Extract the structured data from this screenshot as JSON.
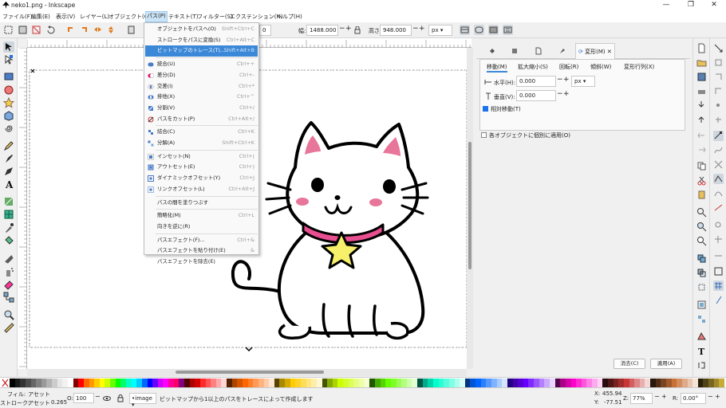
{
  "window": {
    "title": "neko1.png - Inkscape",
    "min": "—",
    "max": "❐",
    "close": "✕"
  },
  "menubar": [
    {
      "label": "ファイル(F)",
      "active": false
    },
    {
      "label": "編集(E)",
      "active": false
    },
    {
      "label": "表示(V)",
      "active": false
    },
    {
      "label": "レイヤー(L)",
      "active": false
    },
    {
      "label": "オブジェクト(O)",
      "active": false
    },
    {
      "label": "パス(P)",
      "active": true
    },
    {
      "label": "テキスト(T)",
      "active": false
    },
    {
      "label": "フィルター(S)",
      "active": false
    },
    {
      "label": "エクステンション(N)",
      "active": false
    },
    {
      "label": "ヘルプ(H)",
      "active": false
    }
  ],
  "command_bar": {
    "width_label": "幅:",
    "width_value": "1488.000",
    "height_label": "高さ:",
    "height_value": "948.000",
    "unit": "px",
    "partial_value": "0"
  },
  "path_menu": [
    {
      "label": "オブジェクトをパスへ(O)",
      "shortcut": "Shift+Ctrl+C",
      "icon": "none"
    },
    {
      "label": "ストロークをパスに変換(S)",
      "shortcut": "Ctrl+Alt+C",
      "icon": "none"
    },
    {
      "label": "ビットマップのトレース(T)...",
      "shortcut": "Shift+Alt+B",
      "icon": "none",
      "highlight": true
    },
    {
      "sep": true
    },
    {
      "label": "統合(U)",
      "shortcut": "Ctrl++",
      "icon": "union"
    },
    {
      "label": "差分(D)",
      "shortcut": "Ctrl+-",
      "icon": "difference"
    },
    {
      "label": "交差(I)",
      "shortcut": "Ctrl+*",
      "icon": "intersection"
    },
    {
      "label": "排他(X)",
      "shortcut": "Ctrl+^",
      "icon": "exclusion"
    },
    {
      "label": "分割(V)",
      "shortcut": "Ctrl+/",
      "icon": "division"
    },
    {
      "label": "パスをカット(P)",
      "shortcut": "Ctrl+Alt+/",
      "icon": "cut-path"
    },
    {
      "sep": true
    },
    {
      "label": "結合(C)",
      "shortcut": "Ctrl+K",
      "icon": "combine"
    },
    {
      "label": "分解(A)",
      "shortcut": "Shift+Ctrl+K",
      "icon": "break-apart"
    },
    {
      "sep": true
    },
    {
      "label": "インセット(N)",
      "shortcut": "Ctrl+(",
      "icon": "inset"
    },
    {
      "label": "アウトセット(E)",
      "shortcut": "Ctrl+)",
      "icon": "outset"
    },
    {
      "label": "ダイナミックオフセット(Y)",
      "shortcut": "Ctrl+J",
      "icon": "dynamic-offset"
    },
    {
      "label": "リンクオフセット(L)",
      "shortcut": "Ctrl+Alt+J",
      "icon": "linked-offset"
    },
    {
      "sep": true
    },
    {
      "label": "パスの間を塗りつぶす",
      "shortcut": "",
      "icon": "none"
    },
    {
      "sep": true
    },
    {
      "label": "簡略化(M)",
      "shortcut": "Ctrl+L",
      "icon": "none"
    },
    {
      "label": "向きを逆に(R)",
      "shortcut": "",
      "icon": "none"
    },
    {
      "sep": true
    },
    {
      "label": "パスエフェクト(F)...",
      "shortcut": "Ctrl+&",
      "icon": "none"
    },
    {
      "label": "パスエフェクトを貼り付け(E)",
      "shortcut": "&",
      "icon": "none"
    },
    {
      "label": "パスエフェクトを除去(E)",
      "shortcut": "",
      "icon": "none"
    }
  ],
  "dock": {
    "active_tab_label": "変形(M)",
    "subtabs": [
      "移動(M)",
      "拡大縮小(S)",
      "回転(R)",
      "傾斜(W)",
      "変形行列(X)"
    ],
    "horizontal_label": "水平(H):",
    "horizontal_value": "0.000",
    "vertical_label": "垂直(V):",
    "vertical_value": "0.000",
    "unit": "px",
    "relative_move_label": "相対移動(T)",
    "apply_each_label": "各オブジェクトに個別に適用(O)",
    "clear_button": "消去(C)",
    "apply_button": "適用(A)"
  },
  "statusbar": {
    "fill_label": "フィル:",
    "fill_value": "アセット",
    "stroke_label": "ストローク:",
    "stroke_value": "アセット",
    "stroke_width": "0.265",
    "opacity_label": "O:",
    "opacity_value": "100",
    "layer_value": "•image",
    "message": "ビットマップから1以上のパスをトレースによって作成します",
    "x_label": "X:",
    "x_value": "455.94",
    "y_label": "Y:",
    "y_value": "-77.51",
    "zoom_label": "Z:",
    "zoom_value": "77%",
    "rotate_label": "R:",
    "rotate_value": "0.00°"
  },
  "colors": {
    "accent": "#3b88d8",
    "cat_pink": "#e8769a",
    "collar": "#e84f91",
    "star": "#f7f06b"
  },
  "palette": [
    "#000000",
    "#1a1a1a",
    "#333333",
    "#4d4d4d",
    "#666666",
    "#808080",
    "#999999",
    "#b3b3b3",
    "#cccccc",
    "#e6e6e6",
    "#f2f2f2",
    "#ffffff",
    "#800000",
    "#ff0000",
    "#ff6600",
    "#ff9900",
    "#ffcc00",
    "#ffff00",
    "#ccff00",
    "#66ff00",
    "#00ff00",
    "#00ff66",
    "#00ffcc",
    "#00ffff",
    "#00ccff",
    "#0066ff",
    "#0000ff",
    "#6600ff",
    "#cc00ff",
    "#ff00ff",
    "#ff0099",
    "#ff0066",
    "#800080",
    "#550000",
    "#aa0000",
    "#d40000",
    "#ff2a2a",
    "#ff5555",
    "#ff8080",
    "#ffaaaa",
    "#ffd5d5",
    "#552200",
    "#aa4400",
    "#d45500",
    "#ff6600",
    "#ff7f2a",
    "#ff9955",
    "#ffb380",
    "#ffccaa",
    "#ffe6d5",
    "#554400",
    "#aa8800",
    "#d4aa00",
    "#ffcc00",
    "#ffd42a",
    "#ffdd55",
    "#ffe680",
    "#ffeeaa",
    "#fff6d5",
    "#445500",
    "#88aa00",
    "#aad400",
    "#ccff00",
    "#d4ff2a",
    "#ddff55",
    "#e5ff80",
    "#eeffaa",
    "#f6ffd5",
    "#225500",
    "#44aa00",
    "#55d400",
    "#66ff00",
    "#7fff2a",
    "#99ff55",
    "#b3ff80",
    "#ccffaa",
    "#e5ffd5",
    "#005544",
    "#00aa88",
    "#00d4aa",
    "#00ffcc",
    "#2affd5",
    "#55ffdd",
    "#80ffe6",
    "#aaffee",
    "#d5fff6",
    "#003380",
    "#0055d4",
    "#0066ff",
    "#2a7fff",
    "#5599ff",
    "#80b3ff",
    "#aaccff",
    "#d5e5ff",
    "#220080",
    "#4400aa",
    "#5500d4",
    "#6600ff",
    "#7f2aff",
    "#9955ff",
    "#b380ff",
    "#ccaaff",
    "#e5d5ff",
    "#55004d",
    "#aa0088",
    "#d400aa",
    "#ff00cc",
    "#ff2ad4",
    "#ff55dd",
    "#ff80e6",
    "#ffaaee",
    "#ffd5f6",
    "#280b0b",
    "#501616",
    "#782121",
    "#a02c2c",
    "#c83737",
    "#d35f5f",
    "#de8787",
    "#e9afaf",
    "#f4d7d7",
    "#28170b",
    "#502d16",
    "#784421",
    "#a05a2c",
    "#c87137",
    "#d38d5f",
    "#deaa87",
    "#e9c6af",
    "#f4e3d7",
    "#28220b",
    "#504416",
    "#786721",
    "#a0892c",
    "#c8ab37"
  ]
}
